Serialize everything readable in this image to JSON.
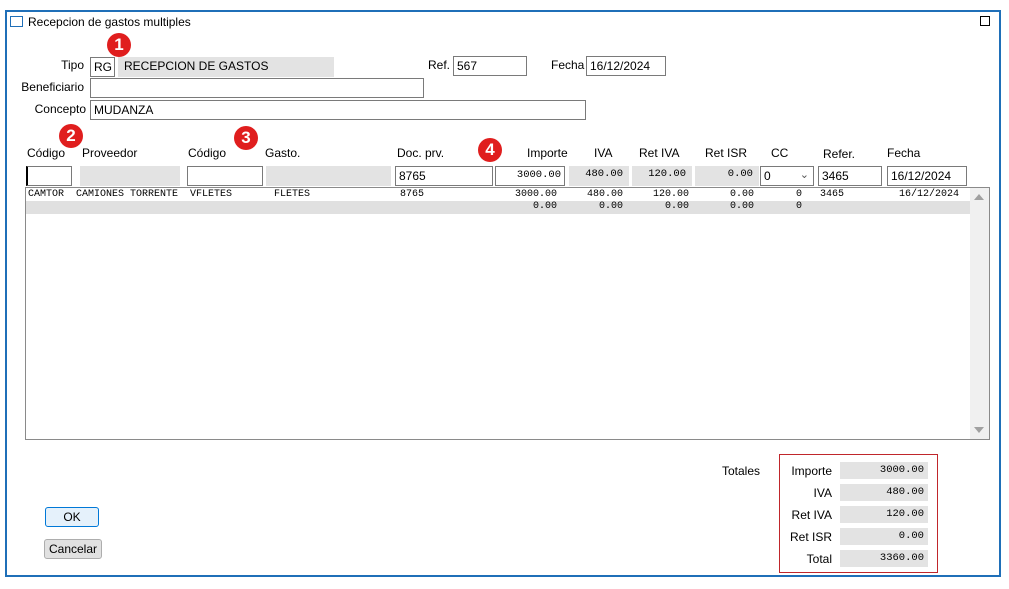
{
  "window": {
    "title": "Recepcion de gastos multiples"
  },
  "header": {
    "tipo_label": "Tipo",
    "tipo_code": "RG",
    "tipo_desc": "RECEPCION DE GASTOS",
    "ref_label": "Ref.",
    "ref_value": "567",
    "fecha_label": "Fecha",
    "fecha_value": "16/12/2024",
    "beneficiario_label": "Beneficiario",
    "beneficiario_value": "",
    "concepto_label": "Concepto",
    "concepto_value": "MUDANZA"
  },
  "badges": [
    "1",
    "2",
    "3",
    "4"
  ],
  "columns": {
    "codigo1": "Código",
    "proveedor": "Proveedor",
    "codigo2": "Código",
    "gasto": "Gasto.",
    "doc_prv": "Doc. prv.",
    "importe": "Importe",
    "iva": "IVA",
    "ret_iva": "Ret IVA",
    "ret_isr": "Ret ISR",
    "cc": "CC",
    "refer": "Refer.",
    "fecha": "Fecha"
  },
  "entry": {
    "codigo_proveedor": "",
    "proveedor_name": "",
    "codigo_gasto": "",
    "gasto_name": "",
    "doc_prv": "8765",
    "importe": "3000.00",
    "iva": "480.00",
    "ret_iva": "120.00",
    "ret_isr": "0.00",
    "cc": "0",
    "refer": "3465",
    "fecha": "16/12/2024"
  },
  "rows": [
    {
      "codigo": "CAMTOR",
      "proveedor": "CAMIONES TORRENTE",
      "codigo_gasto": "VFLETES",
      "gasto": "FLETES",
      "doc_prv": "8765",
      "importe": "3000.00",
      "iva": "480.00",
      "ret_iva": "120.00",
      "ret_isr": "0.00",
      "cc": "0",
      "refer": "3465",
      "fecha": "16/12/2024"
    },
    {
      "codigo": "",
      "proveedor": "",
      "codigo_gasto": "",
      "gasto": "",
      "doc_prv": "",
      "importe": "0.00",
      "iva": "0.00",
      "ret_iva": "0.00",
      "ret_isr": "0.00",
      "cc": "0",
      "refer": "",
      "fecha": ""
    }
  ],
  "totals": {
    "label": "Totales",
    "importe_label": "Importe",
    "importe": "3000.00",
    "iva_label": "IVA",
    "iva": "480.00",
    "ret_iva_label": "Ret IVA",
    "ret_iva": "120.00",
    "ret_isr_label": "Ret ISR",
    "ret_isr": "0.00",
    "total_label": "Total",
    "total": "3360.00"
  },
  "buttons": {
    "ok": "OK",
    "cancel": "Cancelar"
  },
  "colors": {
    "frame": "#1f6fb8",
    "badge": "#e01e1e",
    "totals_border": "#c0262b"
  }
}
